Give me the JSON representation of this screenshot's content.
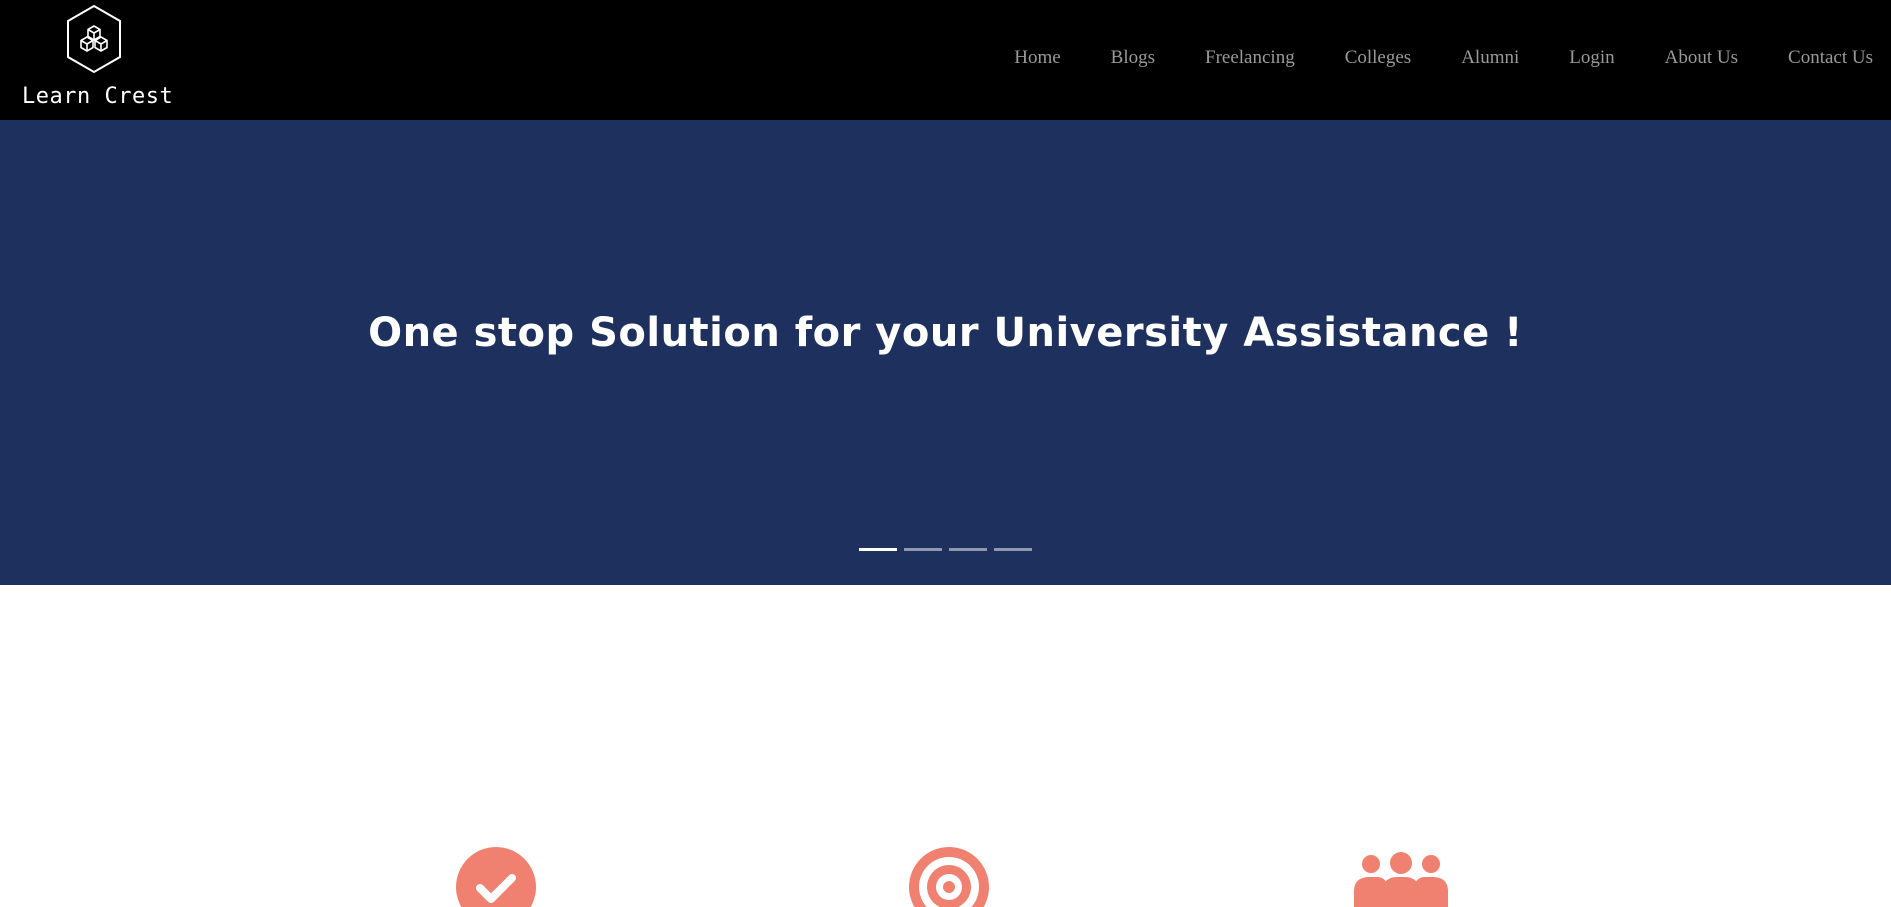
{
  "brand": {
    "name": "Learn Crest",
    "logo_icon": "hexagon-cubes-logo"
  },
  "nav": {
    "items": [
      {
        "label": "Home"
      },
      {
        "label": "Blogs"
      },
      {
        "label": "Freelancing"
      },
      {
        "label": "Colleges"
      },
      {
        "label": "Alumni"
      },
      {
        "label": "Login"
      },
      {
        "label": "About Us"
      },
      {
        "label": "Contact Us"
      }
    ]
  },
  "hero": {
    "title": "One stop Solution for your University Assistance !",
    "slides_total": 4,
    "active_slide": 1
  },
  "features": {
    "icons": [
      "check-circle-icon",
      "target-icon",
      "team-icon"
    ]
  },
  "colors": {
    "navbar_bg": "#000000",
    "hero_bg": "#1e305e",
    "nav_link": "#9a9a9a",
    "accent": "#f0806f"
  }
}
